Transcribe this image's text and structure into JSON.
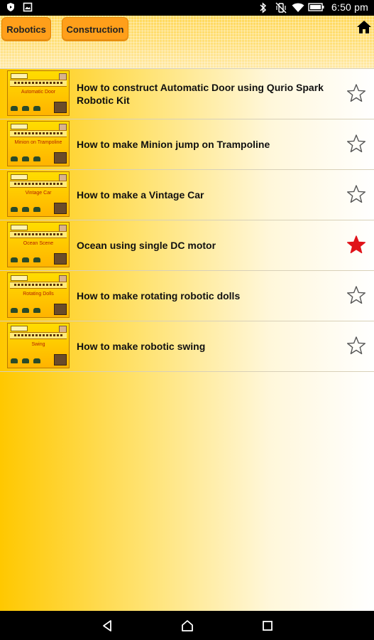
{
  "status_bar": {
    "time": "6:50 pm",
    "left_icons": [
      "shield-icon",
      "image-icon"
    ],
    "right_icons": [
      "bluetooth-icon",
      "vibrate-off-icon",
      "wifi-icon",
      "battery-icon"
    ]
  },
  "header": {
    "tabs": [
      {
        "label": "Robotics"
      },
      {
        "label": "Construction"
      }
    ],
    "home_icon": "home-icon"
  },
  "list": {
    "items": [
      {
        "title": "How to construct Automatic Door using Qurio Spark Robotic Kit",
        "thumb_caption": "Automatic Door",
        "favorite": false
      },
      {
        "title": "How to make Minion jump on Trampoline",
        "thumb_caption": "Minion on Trampoline",
        "favorite": false
      },
      {
        "title": "How to make a Vintage Car",
        "thumb_caption": "Vintage Car",
        "favorite": false
      },
      {
        "title": "Ocean using single DC motor",
        "thumb_caption": "Ocean Scene",
        "favorite": true
      },
      {
        "title": "How to make rotating robotic dolls",
        "thumb_caption": "Rotating Dolls",
        "favorite": false
      },
      {
        "title": "How to make robotic swing",
        "thumb_caption": "Swing",
        "favorite": false
      }
    ]
  },
  "thumbnail": {
    "heading": "Robotics Construction"
  },
  "colors": {
    "tab_bg": "#ff9f1a",
    "star_active": "#e0131a",
    "star_inactive": "#555555"
  },
  "nav_bar": {
    "icons": [
      "back-icon",
      "home-nav-icon",
      "recents-icon"
    ]
  }
}
